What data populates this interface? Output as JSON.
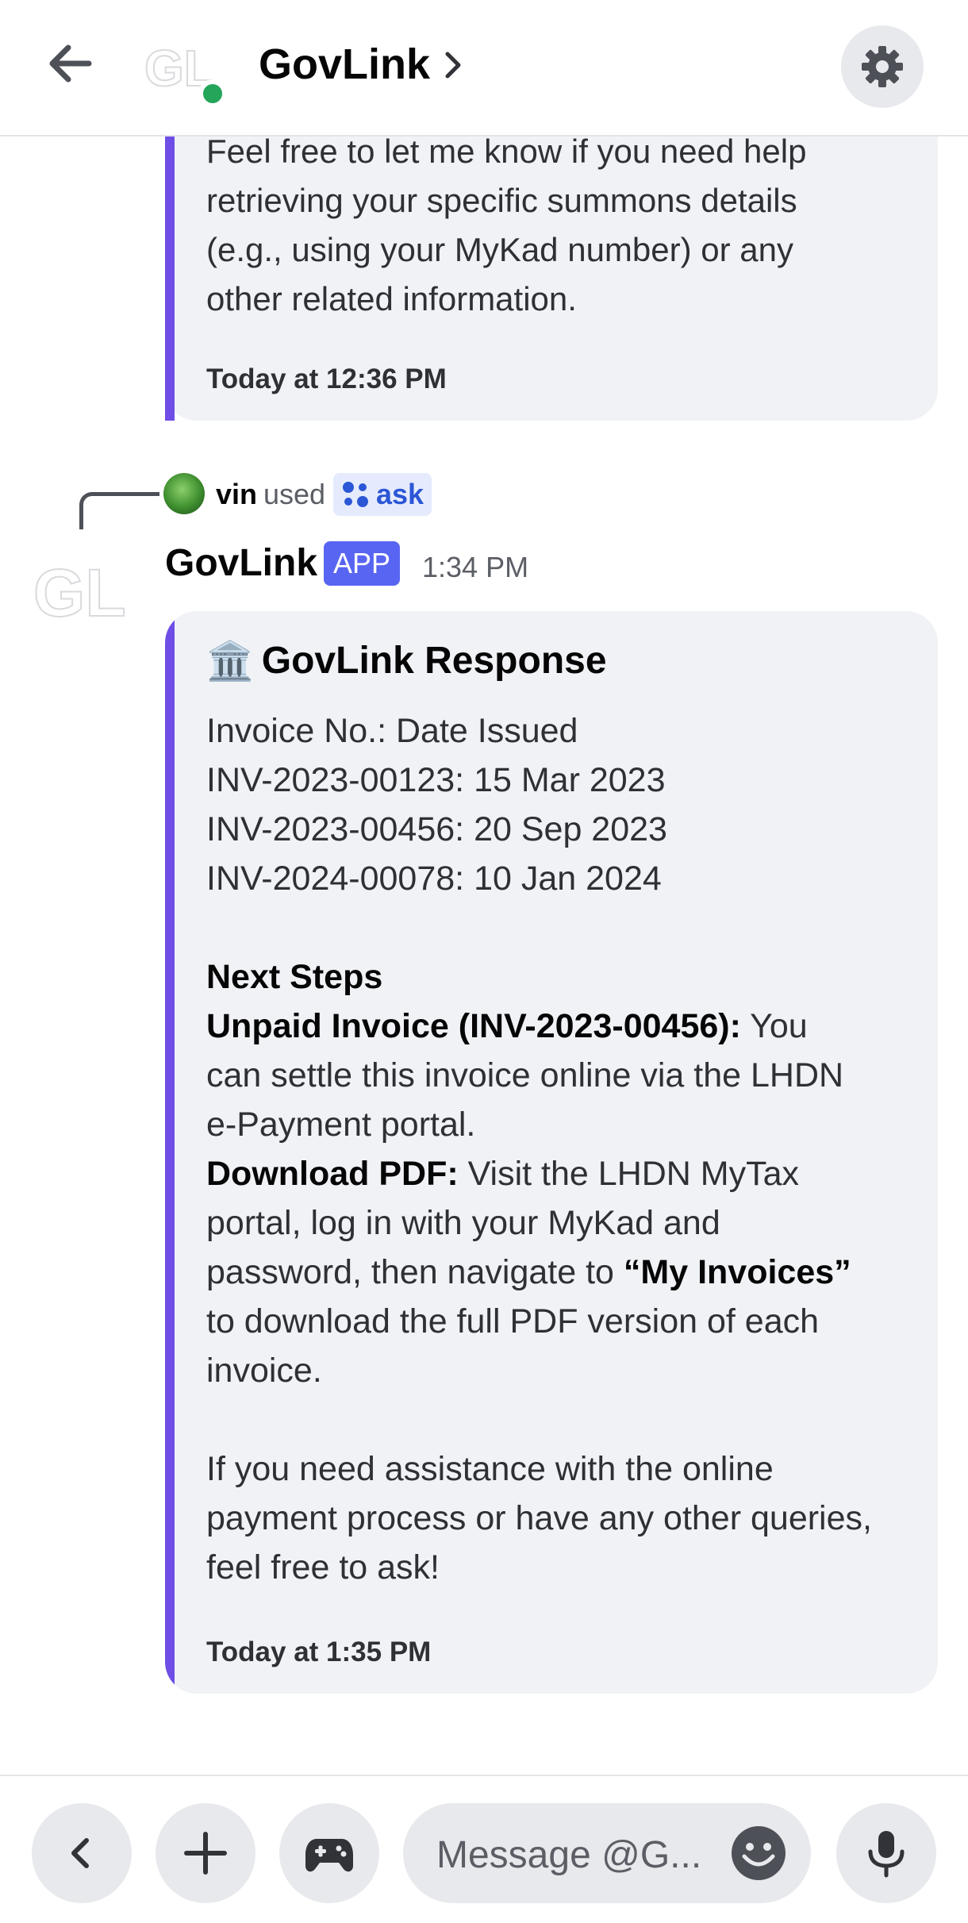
{
  "header": {
    "title": "GovLink",
    "avatar_text": "GL"
  },
  "previous_message": {
    "lines": [
      "Feel free to let me know if you need help",
      "retrieving your specific summons details",
      "(e.g., using your MyKad number) or any",
      "other related information."
    ],
    "timestamp": "Today at 12:36 PM"
  },
  "interaction": {
    "user": "vin",
    "used_text": "used",
    "command": "ask"
  },
  "message": {
    "author": "GovLink",
    "badge": "APP",
    "time": "1:34 PM",
    "avatar_text": "GL"
  },
  "embed": {
    "title_icon": "🏛️",
    "title": "GovLink Response",
    "invoice_header": "Invoice No.: Date Issued",
    "invoices": [
      "INV-2023-00123: 15 Mar 2023",
      "INV-2023-00456: 20 Sep 2023",
      "INV-2024-00078: 10 Jan 2024"
    ],
    "next_steps_heading": "Next Steps",
    "unpaid_label": "Unpaid Invoice (INV-2023-00456):",
    "unpaid_line1_rest": " You",
    "unpaid_line2": "can settle this invoice online via the LHDN",
    "unpaid_line3": "e-Payment portal.",
    "download_label": "Download PDF:",
    "download_line1_rest": " Visit the LHDN MyTax",
    "download_line2": "portal, log in with your MyKad and",
    "download_line3_pre": "password, then navigate to ",
    "download_line3_bold": "“My Invoices”",
    "download_line4": "to download the full PDF version of each",
    "download_line5": "invoice.",
    "closing_lines": [
      "If you need assistance with the online",
      "payment process or have any other queries,",
      "feel free to ask!"
    ],
    "timestamp": "Today at 1:35 PM"
  },
  "composer": {
    "placeholder": "Message @G..."
  },
  "colors": {
    "accent": "#6e4ee6",
    "app_badge": "#5865f2",
    "online": "#23a55a",
    "command": "#2b56d6"
  }
}
